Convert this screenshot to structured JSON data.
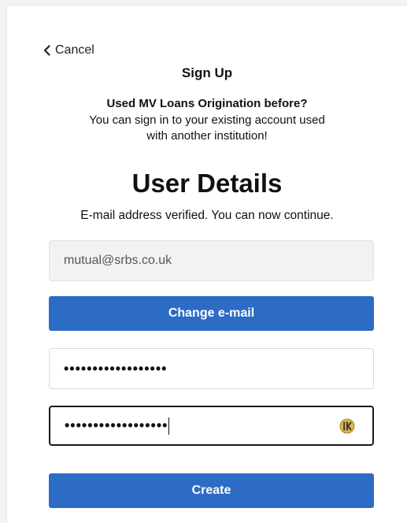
{
  "header": {
    "cancel_label": "Cancel",
    "title": "Sign Up"
  },
  "prompt": {
    "title": "Used MV Loans Origination before?",
    "line1": "You can sign in to your existing account used",
    "line2": "with another institution!"
  },
  "form": {
    "heading": "User Details",
    "verified_text": "E-mail address verified. You can now continue.",
    "email_value": "mutual@srbs.co.uk",
    "change_email_label": "Change e-mail",
    "password_mask": "••••••••••••••••••",
    "confirm_password_mask": "••••••••••••••••••",
    "create_label": "Create"
  },
  "icons": {
    "back": "chevron-left-icon",
    "password_manager": "password-manager-icon"
  },
  "colors": {
    "primary_button": "#2d6cc5",
    "field_readonly_bg": "#f2f2f2"
  }
}
